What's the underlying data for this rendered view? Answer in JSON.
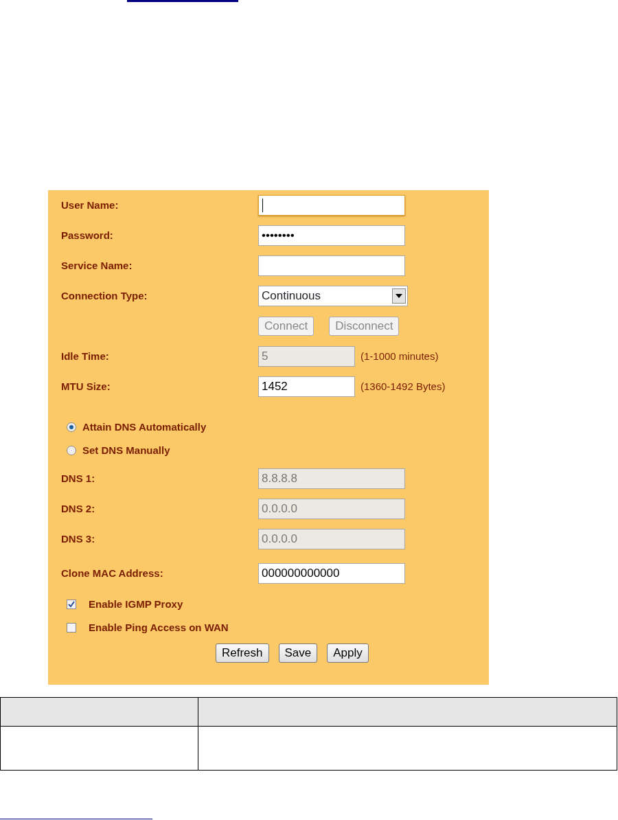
{
  "form_rows": [
    {
      "kind": "text",
      "label": "User Name:",
      "value": "",
      "focused": true,
      "disabled": false
    },
    {
      "kind": "password",
      "label": "Password:",
      "value": "••••••••",
      "focused": false,
      "disabled": false
    },
    {
      "kind": "text",
      "label": "Service Name:",
      "value": "",
      "focused": false,
      "disabled": false
    },
    {
      "kind": "select",
      "label": "Connection Type:",
      "value": "Continuous"
    },
    {
      "kind": "buttons",
      "buttons": [
        {
          "label": "Connect",
          "disabled": true
        },
        {
          "label": "Disconnect",
          "disabled": true
        }
      ]
    },
    {
      "kind": "short",
      "label": "Idle Time:",
      "value": "5",
      "hint": "(1-1000 minutes)",
      "focused": false,
      "disabled": true
    },
    {
      "kind": "short",
      "label": "MTU Size:",
      "value": "1452",
      "hint": "(1360-1492 Bytes)",
      "focused": false,
      "disabled": false
    }
  ],
  "dns_mode": [
    {
      "label": "Attain DNS Automatically",
      "selected": true
    },
    {
      "label": "Set DNS Manually",
      "selected": false
    }
  ],
  "dns_rows": [
    {
      "label": "DNS 1:",
      "value": "8.8.8.8",
      "focused": false,
      "disabled": true
    },
    {
      "label": "DNS 2:",
      "value": "0.0.0.0",
      "focused": false,
      "disabled": true
    },
    {
      "label": "DNS 3:",
      "value": "0.0.0.0",
      "focused": false,
      "disabled": true
    },
    {
      "label": "Clone MAC Address:",
      "value": "000000000000",
      "focused": false,
      "disabled": false
    }
  ],
  "options": [
    {
      "label": "Enable IGMP Proxy",
      "checked": true
    },
    {
      "label": "Enable Ping Access on WAN",
      "checked": false
    }
  ],
  "actions": [
    {
      "label": "Refresh"
    },
    {
      "label": "Save"
    },
    {
      "label": "Apply"
    }
  ]
}
